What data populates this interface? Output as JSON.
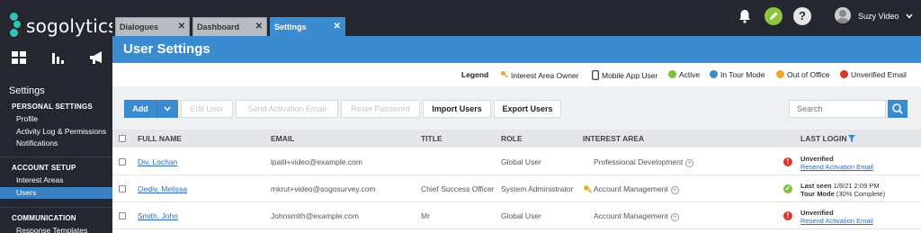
{
  "app": {
    "logo_text": "sogolytics",
    "brand_color": "#2ec4b6",
    "accent": "#3b8bd0"
  },
  "sidebar": {
    "icons": [
      "dashboard-grid-icon",
      "bar-chart-icon",
      "megaphone-icon"
    ],
    "title": "Settings",
    "personal_header": "Personal Settings",
    "personal_items": [
      "Profile",
      "Activity Log & Permissions",
      "Notifications"
    ],
    "account_header": "Account Setup",
    "account_items": [
      "Interest Areas",
      "Users"
    ],
    "communication_header": "Communication",
    "communication_items": [
      "Response Templates"
    ]
  },
  "tabs": [
    {
      "label": "Dialogues",
      "active": false
    },
    {
      "label": "Dashboard",
      "active": false
    },
    {
      "label": "Settings",
      "active": true
    }
  ],
  "user": {
    "name": "Suzy Video"
  },
  "header": {
    "title": "User Settings"
  },
  "legend": {
    "label": "Legend",
    "items": [
      {
        "icon": "key-icon",
        "label": "Interest Area Owner"
      },
      {
        "icon": "mobile-icon",
        "label": "Mobile App User"
      },
      {
        "icon": "active-check-icon",
        "label": "Active",
        "color": "#7cbf3a"
      },
      {
        "icon": "tour-mode-icon",
        "label": "In Tour Mode",
        "color": "#3b8bd0"
      },
      {
        "icon": "out-of-office-icon",
        "label": "Out of Office",
        "color": "#f5a623"
      },
      {
        "icon": "unverified-icon",
        "label": "Unverified Email",
        "color": "#d9372c"
      }
    ]
  },
  "toolbar": {
    "add": "Add",
    "edit_user": "Edit User",
    "send_activation": "Send Activation Email",
    "reset_password": "Reset Password",
    "import_users": "Import Users",
    "export_users": "Export Users",
    "search_placeholder": "Search"
  },
  "table": {
    "columns": [
      "FULL NAME",
      "EMAIL",
      "TITLE",
      "ROLE",
      "INTEREST AREA",
      "LAST LOGIN"
    ],
    "rows": [
      {
        "name": "Div, Lochan",
        "email": "lpatil+video@example.com",
        "title": "",
        "role": "Global User",
        "interest_area": "Professional Development",
        "owner": false,
        "status": "unverified",
        "login_line1": "Unverified",
        "login_line2": "Resend Activation Email"
      },
      {
        "name": "Oediv, Melissa",
        "email": "mkrut+video@sogosurvey.com",
        "title": "Chief Success Officer",
        "role": "System Administrator",
        "interest_area": "Account Management",
        "owner": true,
        "status": "active",
        "login_line1": "Last seen",
        "login_line1_value": "1/8/21 2:09 PM",
        "login_line2": "Tour Mode",
        "login_line2_value": "(30% Complete)"
      },
      {
        "name": "Smith, John",
        "email": "Johnsmith@example.com",
        "title": "Mr",
        "role": "Global User",
        "interest_area": "Account Management",
        "owner": false,
        "status": "unverified",
        "login_line1": "Unverified",
        "login_line2": "Resend Activation Email"
      }
    ]
  }
}
